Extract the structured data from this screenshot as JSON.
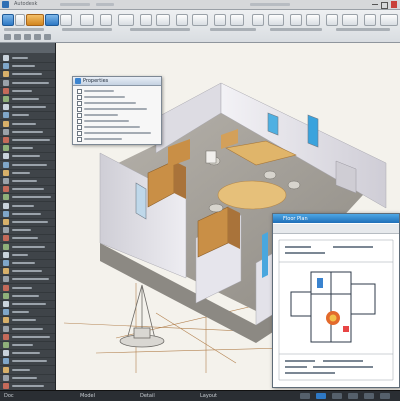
{
  "app": {
    "window_title": "Autodesk"
  },
  "colors": {
    "accent": "#2e78c4",
    "status_bg": "#2a2e33",
    "wall": "#e9e8ee",
    "floor": "#9a968f",
    "wood": "#d6a55a"
  },
  "dialog": {
    "title": "Properties"
  },
  "inset": {
    "title": "Floor Plan"
  },
  "statusbar": {
    "items": [
      "Doc",
      "Model",
      "Detail",
      "Layout"
    ]
  },
  "icons": [
    "app-logo-icon",
    "window-controls-icon",
    "ribbon-tool-icon",
    "layer-icon",
    "dialog-icon",
    "drawing-icon",
    "status-button-icon"
  ]
}
